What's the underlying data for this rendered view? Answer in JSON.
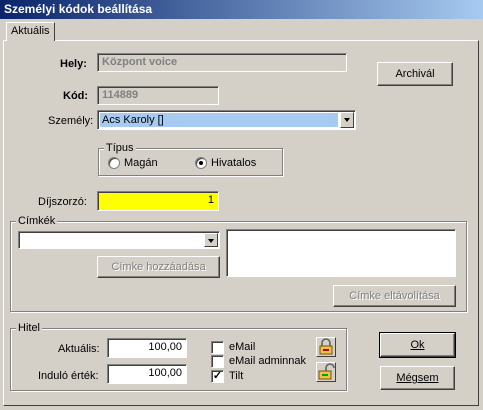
{
  "window": {
    "title": "Személyi kódok beállítása"
  },
  "tabs": [
    {
      "label": "Aktuális"
    }
  ],
  "form": {
    "hely_label": "Hely:",
    "hely_value": "Központ voice",
    "kod_label": "Kód:",
    "kod_value": "114889",
    "szemely_label": "Személy:",
    "szemely_value": "Acs Karoly []",
    "archival_label": "Archivál",
    "tipus": {
      "title": "Típus",
      "options": [
        {
          "label": "Magán",
          "selected": false
        },
        {
          "label": "Hivatalos",
          "selected": true
        }
      ]
    },
    "dijszorzo_label": "Díjszorzó:",
    "dijszorzo_value": "1",
    "dijszorzo_color": "#ffff00"
  },
  "cimkek": {
    "title": "Címkék",
    "dropdown_value": "",
    "add_button": "Címke hozzáadása",
    "remove_button": "Címke eltávolítása"
  },
  "hitel": {
    "title": "Hitel",
    "aktualis_label": "Aktuális:",
    "aktualis_value": "100,00",
    "indulo_label": "Induló érték:",
    "indulo_value": "100,00",
    "checks": [
      {
        "label": "eMail",
        "checked": false
      },
      {
        "label": "eMail adminnak",
        "checked": false
      },
      {
        "label": "Tilt",
        "checked": true
      }
    ],
    "lock_icon": "lock-icon",
    "unlock_icon": "unlock-icon"
  },
  "buttons": {
    "ok": "Ok",
    "cancel": "Mégsem"
  },
  "colors": {
    "title_start": "#0a246a",
    "title_end": "#a6caf0",
    "selection": "#a6caf0"
  }
}
